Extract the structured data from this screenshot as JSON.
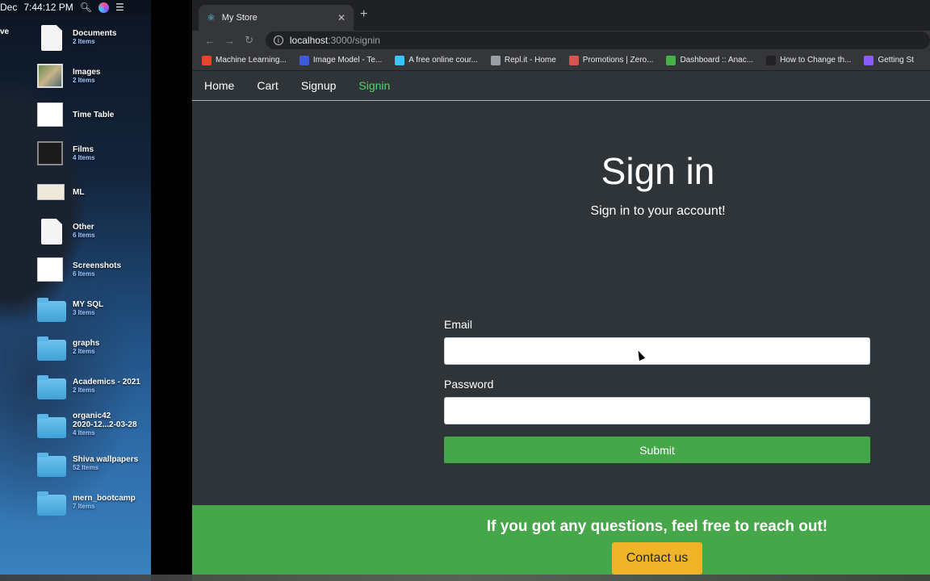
{
  "desktop": {
    "menubar": {
      "date": "Dec",
      "time": "7:44:12 PM"
    },
    "cut_label": "ve",
    "items": [
      {
        "name": "Documents",
        "count": "2 Items",
        "thumb": "doc"
      },
      {
        "name": "Images",
        "count": "2 Items",
        "thumb": "img"
      },
      {
        "name": "Time Table",
        "count": "",
        "thumb": "sheet"
      },
      {
        "name": "Films",
        "count": "4 Items",
        "thumb": "film"
      },
      {
        "name": "ML",
        "count": "",
        "thumb": "paper"
      },
      {
        "name": "Other",
        "count": "6 Items",
        "thumb": "doc"
      },
      {
        "name": "Screenshots",
        "count": "6 Items",
        "thumb": "sheet"
      },
      {
        "name": "MY SQL",
        "count": "3 Items",
        "thumb": "folder"
      },
      {
        "name": "graphs",
        "count": "2 Items",
        "thumb": "folder"
      },
      {
        "name": "Academics - 2021",
        "count": "2 Items",
        "thumb": "folder"
      },
      {
        "name": "organic42\n2020-12...2-03-28",
        "count": "4 Items",
        "thumb": "folder"
      },
      {
        "name": "Shiva wallpapers",
        "count": "52 Items",
        "thumb": "folder"
      },
      {
        "name": "mern_bootcamp",
        "count": "7 Items",
        "thumb": "folder"
      }
    ]
  },
  "browser": {
    "tab_title": "My Store",
    "url_host": "localhost",
    "url_path": ":3000/signin",
    "bookmarks": [
      {
        "label": "Machine Learning...",
        "color": "#e8452c"
      },
      {
        "label": "Image Model - Te...",
        "color": "#3b5bdb"
      },
      {
        "label": "A free online cour...",
        "color": "#3fc3ff"
      },
      {
        "label": "Repl.it - Home",
        "color": "#9aa0a6"
      },
      {
        "label": "Promotions | Zero...",
        "color": "#d9534f"
      },
      {
        "label": "Dashboard :: Anac...",
        "color": "#44b244"
      },
      {
        "label": "How to Change th...",
        "color": "#222222"
      },
      {
        "label": "Getting St",
        "color": "#8a5cff"
      }
    ]
  },
  "page": {
    "nav": [
      {
        "label": "Home",
        "active": false
      },
      {
        "label": "Cart",
        "active": false
      },
      {
        "label": "Signup",
        "active": false
      },
      {
        "label": "Signin",
        "active": true
      }
    ],
    "title": "Sign in",
    "subtitle": "Sign in to your account!",
    "form": {
      "email_label": "Email",
      "email_value": "",
      "password_label": "Password",
      "password_value": "",
      "submit_label": "Submit"
    },
    "footer": {
      "heading": "If you got any questions, feel free to reach out!",
      "contact_label": "Contact us"
    }
  },
  "colors": {
    "accent_green": "#46a64a",
    "active_nav": "#4cd964",
    "contact_button": "#f0b429",
    "page_bg": "#2f3439"
  }
}
